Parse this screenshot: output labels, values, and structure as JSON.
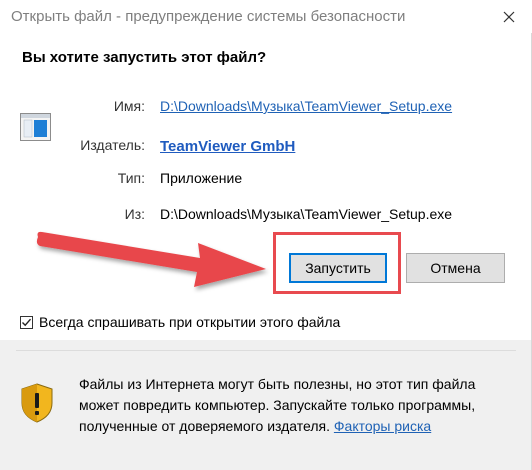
{
  "window": {
    "title": "Открыть файл - предупреждение системы безопасности"
  },
  "question": "Вы хотите запустить этот файл?",
  "fields": {
    "name_label": "Имя:",
    "name_value": "D:\\Downloads\\Музыка\\TeamViewer_Setup.exe",
    "publisher_label": "Издатель:",
    "publisher_value": "TeamViewer GmbH",
    "type_label": "Тип:",
    "type_value": "Приложение",
    "from_label": "Из:",
    "from_value": "D:\\Downloads\\Музыка\\TeamViewer_Setup.exe"
  },
  "buttons": {
    "run_label": "Запустить",
    "cancel_label": "Отмена"
  },
  "checkbox": {
    "label": "Всегда спрашивать при открытии этого файла",
    "checked": true
  },
  "warning": {
    "text": "Файлы из Интернета могут быть полезны, но этот тип файла может повредить компьютер. Запускайте только программы, полученные от доверяемого издателя.",
    "link_text": "Факторы риска"
  },
  "colors": {
    "link": "#1f62b5",
    "highlight": "#e84a4f",
    "button_focus": "#0078d7"
  }
}
